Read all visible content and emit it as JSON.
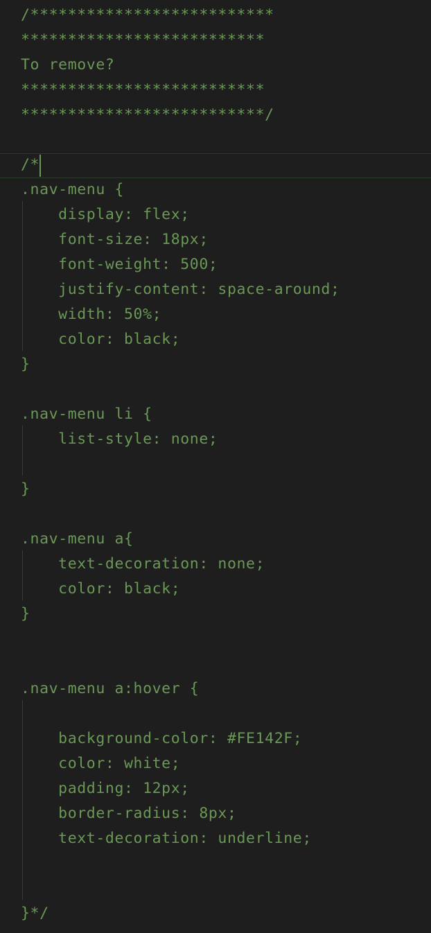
{
  "editor": {
    "theme": {
      "background": "#1e1e1e",
      "comment_color": "#6a9955"
    },
    "lines": [
      "/**************************",
      "**************************",
      "To remove?",
      "**************************",
      "**************************/",
      "",
      "/*",
      ".nav-menu {",
      "    display: flex;",
      "    font-size: 18px;",
      "    font-weight: 500;",
      "    justify-content: space-around;",
      "    width: 50%;",
      "    color: black;",
      "}",
      "",
      ".nav-menu li {",
      "    list-style: none;",
      "",
      "}",
      "",
      ".nav-menu a{",
      "    text-decoration: none;",
      "    color: black;",
      "}",
      "",
      "",
      ".nav-menu a:hover {",
      "",
      "    background-color: #FE142F;",
      "    color: white;",
      "    padding: 12px;",
      "    border-radius: 8px;",
      "    text-decoration: underline;",
      "",
      "",
      "}*/"
    ]
  }
}
